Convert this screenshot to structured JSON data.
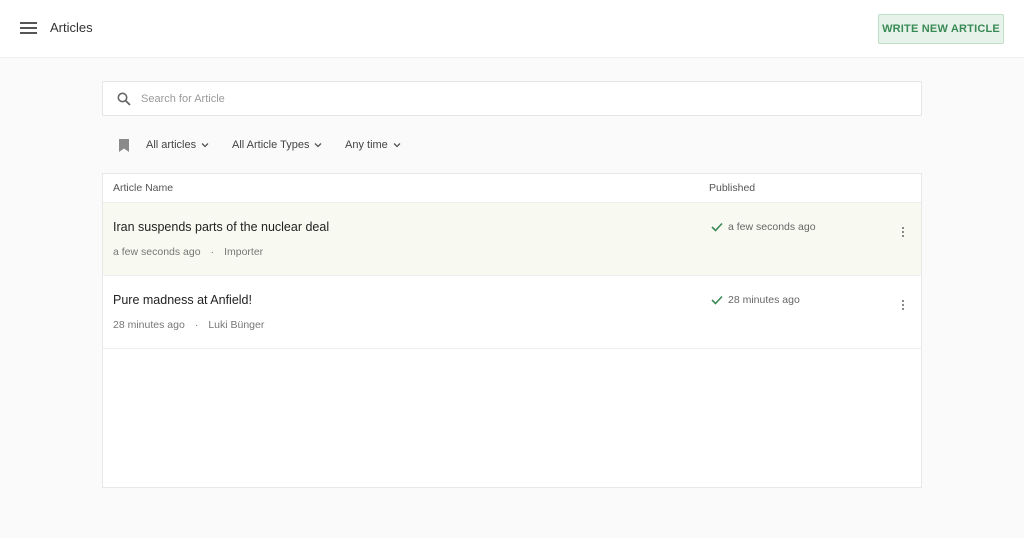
{
  "header": {
    "title": "Articles",
    "menu_icon": "hamburger-menu-icon",
    "write_button_label": "WRITE NEW ARTICLE"
  },
  "search": {
    "placeholder": "Search for Article",
    "value": "",
    "icon": "search-icon"
  },
  "filters": {
    "bookmark_icon": "bookmark-icon",
    "items": [
      {
        "label": "All articles"
      },
      {
        "label": "All Article Types"
      },
      {
        "label": "Any time"
      }
    ]
  },
  "table": {
    "columns": [
      "Article Name",
      "Published"
    ],
    "rows": [
      {
        "title": "Iran suspends parts of the nuclear deal",
        "created": "a few seconds ago",
        "author": "Importer",
        "published": "a few seconds ago",
        "highlighted": true
      },
      {
        "title": "Pure madness at Anfield!",
        "created": "28 minutes ago",
        "author": "Luki Bünger",
        "published": "28 minutes ago",
        "highlighted": false
      }
    ]
  },
  "colors": {
    "accent": "#3a8a55",
    "accent_bg": "#e7f3ea",
    "row_highlight": "#f8faf2"
  }
}
